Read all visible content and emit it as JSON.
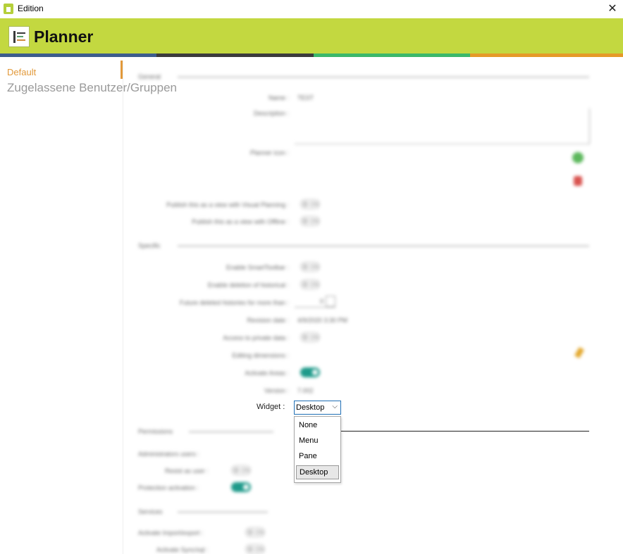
{
  "window": {
    "title": "Edition",
    "close_glyph": "✕"
  },
  "header": {
    "app_name": "Planner",
    "logo_icon": "planner-logo-icon"
  },
  "brand_colors": {
    "header_bg": "#c3d840",
    "stripe": [
      "#3d5d8d",
      "#3b3b3b",
      "#3bb86a",
      "#e59a28"
    ],
    "accent": "#e2993a",
    "toggle_on": "#1e9a8a"
  },
  "sidebar": {
    "items": [
      {
        "label": "Default"
      },
      {
        "label": "Zugelassene Benutzer/Gruppen"
      }
    ]
  },
  "form": {
    "sections": [
      {
        "label": "General"
      },
      {
        "label": "Specific"
      },
      {
        "label": "Permissions"
      },
      {
        "label": "Services"
      }
    ],
    "fields": {
      "name": {
        "label": "Name :",
        "value": "TEST"
      },
      "description": {
        "label": "Description :"
      },
      "planner_icon": {
        "label": "Planner icon :"
      },
      "publish_visual": {
        "label": "Publish this as a view with Visual Planning :",
        "toggle": "ON"
      },
      "publish_offline": {
        "label": "Publish this as a view with Offline :",
        "toggle": "ON"
      },
      "enable_smart_toolbar": {
        "label": "Enable SmartToolbar :",
        "toggle": "ON"
      },
      "enable_deletion": {
        "label": "Enable deletion of historical :",
        "toggle": "ON"
      },
      "future_deleted": {
        "label": "Future deleted histories for more than :",
        "value": "0"
      },
      "revision_date": {
        "label": "Revision date :",
        "value": "4/9/2020 3:30 PM"
      },
      "access_private": {
        "label": "Access to private data :",
        "toggle": "ON"
      },
      "editing_dimensions": {
        "label": "Editing dimensions :"
      },
      "activate_areas": {
        "label": "Activate Areas :",
        "toggle": "ON"
      },
      "version": {
        "label": "Version :",
        "value": "7.002"
      },
      "administrators": {
        "label": "Administrators users :"
      },
      "resist_user": {
        "label": "Resist as user :",
        "toggle": "ON"
      },
      "protection": {
        "label": "Protection activation :",
        "toggle": "ON"
      },
      "import_export": {
        "label": "Activate Import/export :",
        "toggle": "ON"
      },
      "activate_sync": {
        "label": "Activate Sync/sql :",
        "toggle": "ON"
      }
    },
    "widget": {
      "label": "Widget :",
      "selected": "Desktop",
      "chevron": "⌵",
      "options": [
        "None",
        "Menu",
        "Pane",
        "Desktop"
      ]
    }
  }
}
